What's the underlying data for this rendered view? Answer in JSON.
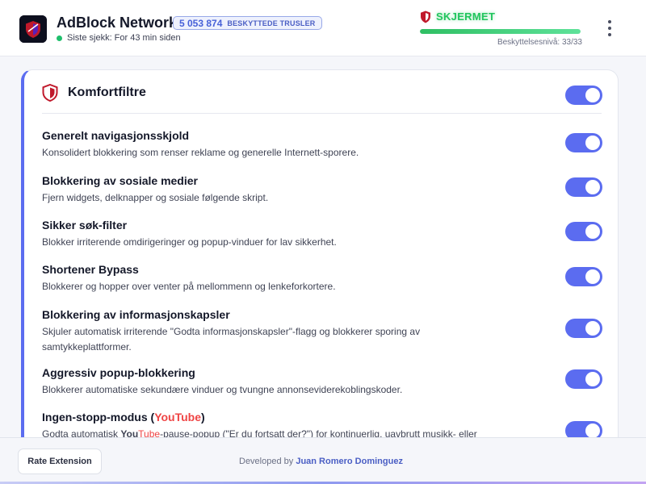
{
  "header": {
    "brand": "AdBlock Network",
    "threat_count": "5 053 874",
    "threat_label": "BESKYTTEDE TRUSLER",
    "last_check": "Siste sjekk: For 43 min siden",
    "status": "SKJERMET",
    "protection_level": "Beskyttelsesnivå: 33/33",
    "protection_fraction": 1.0
  },
  "colors": {
    "accent": "#5b6cf0",
    "status_green": "#22c55e",
    "youtube_red": "#ef4444"
  },
  "card": {
    "title": "Komfortfiltre",
    "master_toggle_on": true,
    "rows": [
      {
        "title": "Generelt navigasjonsskjold",
        "desc": "Konsolidert blokkering som renser reklame og generelle Internett-sporere.",
        "on": true
      },
      {
        "title": "Blokkering av sosiale medier",
        "desc": "Fjern widgets, delknapper og sosiale følgende skript.",
        "on": true
      },
      {
        "title": "Sikker søk-filter",
        "desc": "Blokker irriterende omdirigeringer og popup-vinduer for lav sikkerhet.",
        "on": true
      },
      {
        "title": "Shortener Bypass",
        "desc": "Blokkerer og hopper over venter på mellommenn og lenkeforkortere.",
        "on": true
      },
      {
        "title": "Blokkering av informasjonskapsler",
        "desc": "Skjuler automatisk irriterende \"Godta informasjonskapsler\"-flagg og blokkerer sporing av samtykkeplattformer.",
        "on": true
      },
      {
        "title": "Aggressiv popup-blokkering",
        "desc": "Blokkerer automatiske sekundære vinduer og tvungne annonseviderekoblingskoder.",
        "on": true
      },
      {
        "title_pre": "Ingen-stopp-modus (",
        "title_you": "You",
        "title_tube": "Tube",
        "title_post": ")",
        "desc_pre": "Godta automatisk ",
        "desc_you": "You",
        "desc_tube": "Tube",
        "desc_post": "-pause-popup (\"Er du fortsatt der?\") for kontinuerlig, uavbrutt musikk- eller",
        "on": true
      }
    ]
  },
  "footer": {
    "rate_button": "Rate Extension",
    "developed_by": "Developed by ",
    "developer": "Juan Romero Dominguez"
  }
}
